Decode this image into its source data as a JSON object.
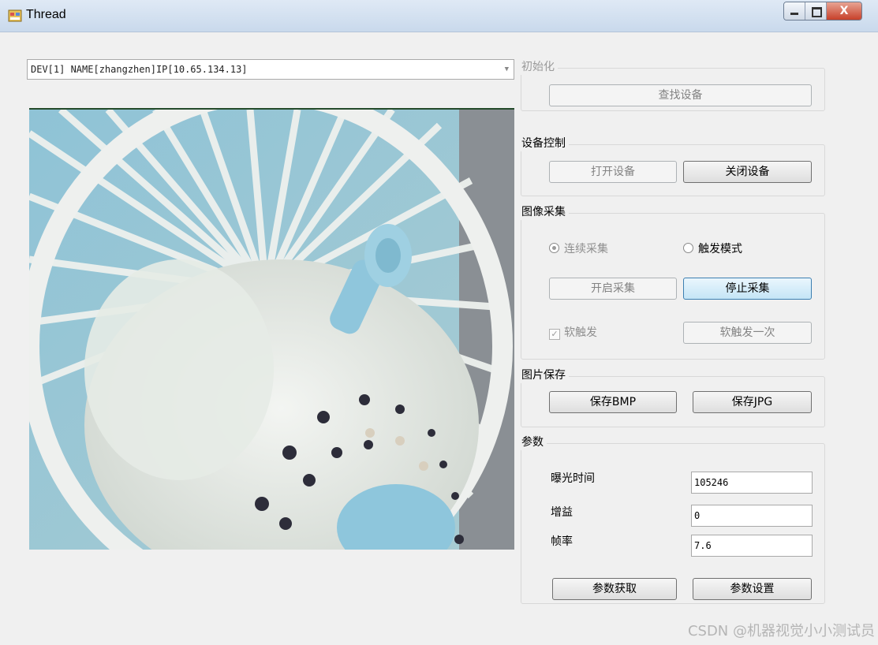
{
  "window": {
    "title": "Thread",
    "close_glyph": "X"
  },
  "device_combo": {
    "value": "DEV[1] NAME[zhangzhen]IP[10.65.134.13]"
  },
  "groups": {
    "init": {
      "title": "初始化",
      "find_button": "查找设备"
    },
    "control": {
      "title": "设备控制",
      "open_button": "打开设备",
      "close_button": "关闭设备"
    },
    "acquisition": {
      "title": "图像采集",
      "continuous_label": "连续采集",
      "trigger_label": "触发模式",
      "start_button": "开启采集",
      "stop_button": "停止采集",
      "soft_trigger_label": "软触发",
      "soft_trigger_once_button": "软触发一次"
    },
    "save": {
      "title": "图片保存",
      "bmp_button": "保存BMP",
      "jpg_button": "保存JPG"
    },
    "params": {
      "title": "参数",
      "exposure_label": "曝光时间",
      "exposure_value": "105246",
      "gain_label": "增益",
      "gain_value": "0",
      "fps_label": "帧率",
      "fps_value": "7.6",
      "get_button": "参数获取",
      "set_button": "参数设置"
    }
  },
  "watermark": "CSDN @机器视觉小小测试员",
  "icons": {
    "app": "app-window-icon",
    "minimize": "minimize-icon",
    "maximize": "maximize-icon",
    "close": "close-icon",
    "combo_arrow": "chevron-down-icon"
  },
  "colors": {
    "titlebar": "#c9d9ec",
    "close_button": "#c7402a",
    "fan_blue": "#8fc3d6"
  }
}
